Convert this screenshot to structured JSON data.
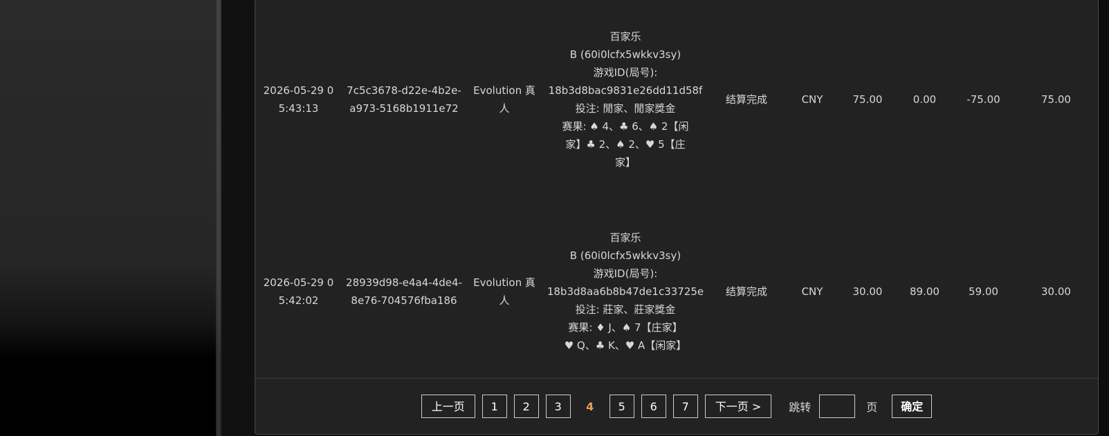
{
  "rows": [
    {
      "time": "2026-05-29 05:43:13",
      "order_id": "7c5c3678-d22e-4b2e-a973-5168b1911e72",
      "platform": "Evolution 真人",
      "detail": {
        "game": "百家乐",
        "table": "B (60i0lcfx5wkkv3sy)",
        "game_id_label": "游戏ID(局号):",
        "game_id": "18b3d8bac9831e26dd11d58f",
        "bet": "投注: 閒家、閒家獎金",
        "result_1": "赛果: ♠ 4、♣ 6、♠ 2【闲",
        "result_2": "家】♣ 2、♠ 2、♥ 5【庄",
        "result_3": "家】"
      },
      "status": "结算完成",
      "currency": "CNY",
      "bet_amount": "75.00",
      "payout": "0.00",
      "win_loss": "-75.00",
      "valid_bet": "75.00"
    },
    {
      "time": "2026-05-29 05:42:02",
      "order_id": "28939d98-e4a4-4de4-8e76-704576fba186",
      "platform": "Evolution 真人",
      "detail": {
        "game": "百家乐",
        "table": "B (60i0lcfx5wkkv3sy)",
        "game_id_label": "游戏ID(局号):",
        "game_id": "18b3d8aa6b8b47de1c33725e",
        "bet": "投注: 莊家、莊家獎金",
        "result_1": "赛果: ♦ J、♠ 7【庄家】",
        "result_2": "♥ Q、♣ K、♥ A【闲家】",
        "result_3": ""
      },
      "status": "结算完成",
      "currency": "CNY",
      "bet_amount": "30.00",
      "payout": "89.00",
      "win_loss": "59.00",
      "valid_bet": "30.00"
    }
  ],
  "pagination": {
    "prev": "上一页",
    "pages": [
      "1",
      "2",
      "3",
      "4",
      "5",
      "6",
      "7"
    ],
    "current": "4",
    "next": "下一页 >",
    "jump_label": "跳转",
    "jump_value": "",
    "page_word": "页",
    "confirm": "确定"
  },
  "colors": {
    "accent_current_page": "#e8a052",
    "panel_bg": "#222222"
  }
}
